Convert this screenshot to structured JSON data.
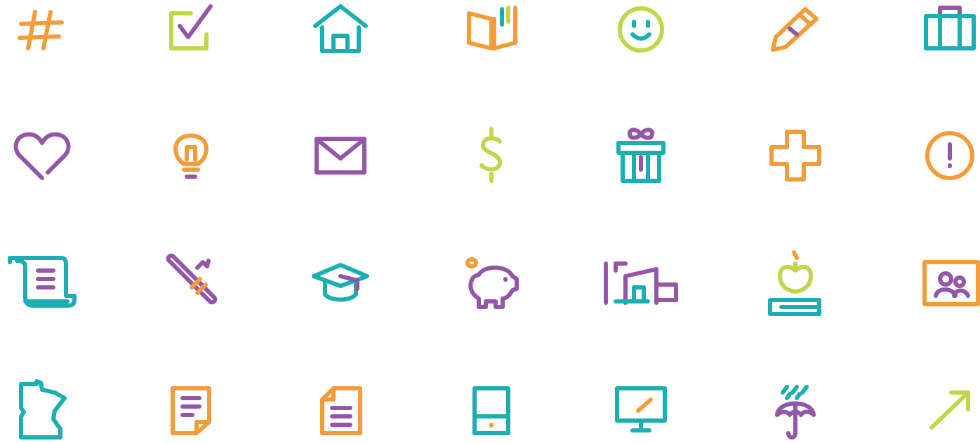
{
  "colors": {
    "orange": "#F59C3A",
    "lime": "#C4D54A",
    "teal": "#1BAEB2",
    "purple": "#9356A8"
  },
  "icons": [
    {
      "name": "hashtag-icon",
      "color": "orange"
    },
    {
      "name": "checkbox-icon",
      "color": "lime"
    },
    {
      "name": "house-icon",
      "color": "teal"
    },
    {
      "name": "book-icon",
      "color": "orange"
    },
    {
      "name": "smiley-icon",
      "color": "lime"
    },
    {
      "name": "pencil-icon",
      "color": "orange"
    },
    {
      "name": "briefcase-icon",
      "color": "teal"
    },
    {
      "name": "heart-icon",
      "color": "purple"
    },
    {
      "name": "lightbulb-icon",
      "color": "orange"
    },
    {
      "name": "envelope-icon",
      "color": "purple"
    },
    {
      "name": "dollar-icon",
      "color": "lime"
    },
    {
      "name": "gift-icon",
      "color": "teal"
    },
    {
      "name": "medical-cross-icon",
      "color": "orange"
    },
    {
      "name": "alert-icon",
      "color": "orange"
    },
    {
      "name": "scroll-icon",
      "color": "teal"
    },
    {
      "name": "diploma-icon",
      "color": "purple"
    },
    {
      "name": "graduation-cap-icon",
      "color": "teal"
    },
    {
      "name": "piggy-bank-icon",
      "color": "purple"
    },
    {
      "name": "buildings-icon",
      "color": "purple"
    },
    {
      "name": "apple-books-icon",
      "color": "lime"
    },
    {
      "name": "family-photo-icon",
      "color": "orange"
    },
    {
      "name": "minnesota-map-icon",
      "color": "teal"
    },
    {
      "name": "document-icon",
      "color": "orange"
    },
    {
      "name": "file-icon",
      "color": "orange"
    },
    {
      "name": "tablet-icon",
      "color": "teal"
    },
    {
      "name": "monitor-icon",
      "color": "teal"
    },
    {
      "name": "umbrella-rain-icon",
      "color": "purple"
    },
    {
      "name": "arrow-up-right-icon",
      "color": "lime"
    }
  ],
  "minnesota_label": "MN"
}
